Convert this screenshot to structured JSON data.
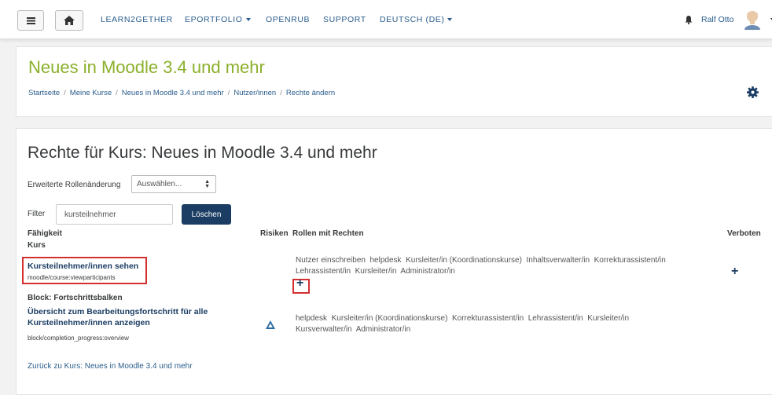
{
  "navbar": {
    "menu_icon": "hamburger-icon",
    "home_icon": "home-icon",
    "links": [
      "LEARN2GETHER",
      "EPORTFOLIO",
      "OPENRUB",
      "SUPPORT",
      "DEUTSCH (DE)"
    ],
    "bell_icon": "bell-icon",
    "user_name": "Ralf Otto"
  },
  "header": {
    "course_title": "Neues in Moodle 3.4 und mehr",
    "breadcrumb": [
      "Startseite",
      "Meine Kurse",
      "Neues in Moodle 3.4 und mehr",
      "Nutzer/innen",
      "Rechte ändern"
    ],
    "settings_icon": "gear-icon"
  },
  "main": {
    "page_title": "Rechte für Kurs: Neues in Moodle 3.4 und mehr",
    "advanced_label": "Erweiterte Rollenänderung",
    "advanced_select": "Auswählen...",
    "filter_label": "Filter",
    "filter_value": "kursteilnehmer",
    "clear_button": "Löschen",
    "columns": {
      "capability": "Fähigkeit",
      "risks": "Risiken",
      "roles": "Rollen mit Rechten",
      "prohibited": "Verboten"
    },
    "groups": [
      {
        "heading": "Kurs",
        "capability": "Kursteilnehmer/innen sehen",
        "code": "moodle/course:viewparticipants",
        "roles_line1": "Nutzer einschreiben  helpdesk  Kursleiter/in (Koordinationskurse)  Inhaltsverwalter/in  Korrekturassistent/in",
        "roles_line2": "Lehrassistent/in  Kursleiter/in  Administrator/in"
      },
      {
        "heading": "Block: Fortschrittsbalken",
        "capability_line1": "Übersicht zum Bearbeitungsfortschritt für alle",
        "capability_line2": "Kursteilnehmer/innen anzeigen",
        "code": "block/completion_progress:overview",
        "risk_icon": "risk-triangle-icon",
        "roles_line1": "helpdesk  Kursleiter/in (Koordinationskurse)  Korrekturassistent/in  Lehrassistent/in  Kursleiter/in",
        "roles_line2": "Kursverwalter/in  Administrator/in"
      }
    ],
    "back_link": "Zurück zu Kurs: Neues in Moodle 3.4 und mehr"
  }
}
